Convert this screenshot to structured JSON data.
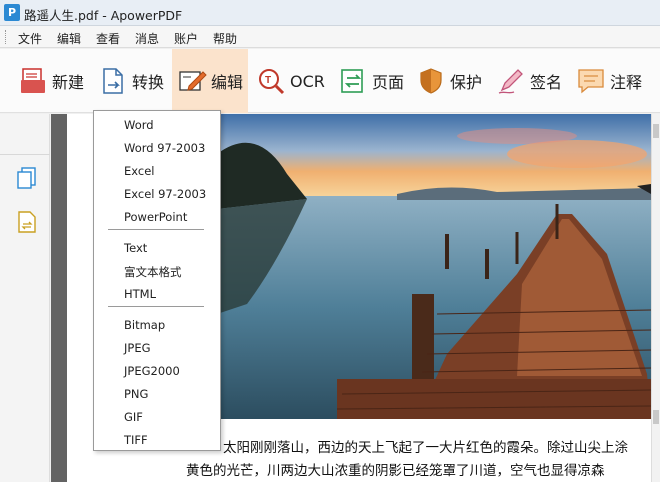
{
  "window": {
    "title": "路遥人生.pdf - ApowerPDF",
    "logo_letter": "P"
  },
  "menu": [
    "文件",
    "编辑",
    "查看",
    "消息",
    "账户",
    "帮助"
  ],
  "toolbar": [
    {
      "label": "新建",
      "icon": "new-file-icon"
    },
    {
      "label": "转换",
      "icon": "convert-icon"
    },
    {
      "label": "编辑",
      "icon": "edit-icon",
      "active": true
    },
    {
      "label": "OCR",
      "icon": "ocr-icon"
    },
    {
      "label": "页面",
      "icon": "page-icon"
    },
    {
      "label": "保护",
      "icon": "shield-icon"
    },
    {
      "label": "签名",
      "icon": "pen-icon"
    },
    {
      "label": "注释",
      "icon": "comment-icon"
    }
  ],
  "convert_menu": {
    "group1": [
      "Word",
      "Word 97-2003",
      "Excel",
      "Excel 97-2003",
      "PowerPoint"
    ],
    "group2": [
      "Text",
      "富文本格式",
      "HTML"
    ],
    "group3": [
      "Bitmap",
      "JPEG",
      "JPEG2000",
      "PNG",
      "GIF",
      "TIFF"
    ]
  },
  "document": {
    "line1": "太阳刚刚落山，西边的天上飞起了一大片红色的霞朵。除过山尖上涂",
    "line2": "黄色的光芒，川两边大山浓重的阴影已经笼罩了川道，空气也显得凉森"
  },
  "colors": {
    "toolbar_active_bg": "#fbe3cc",
    "logo_blue": "#2b89d3",
    "accent_red": "#d9534f",
    "accent_green": "#2e9d55"
  }
}
